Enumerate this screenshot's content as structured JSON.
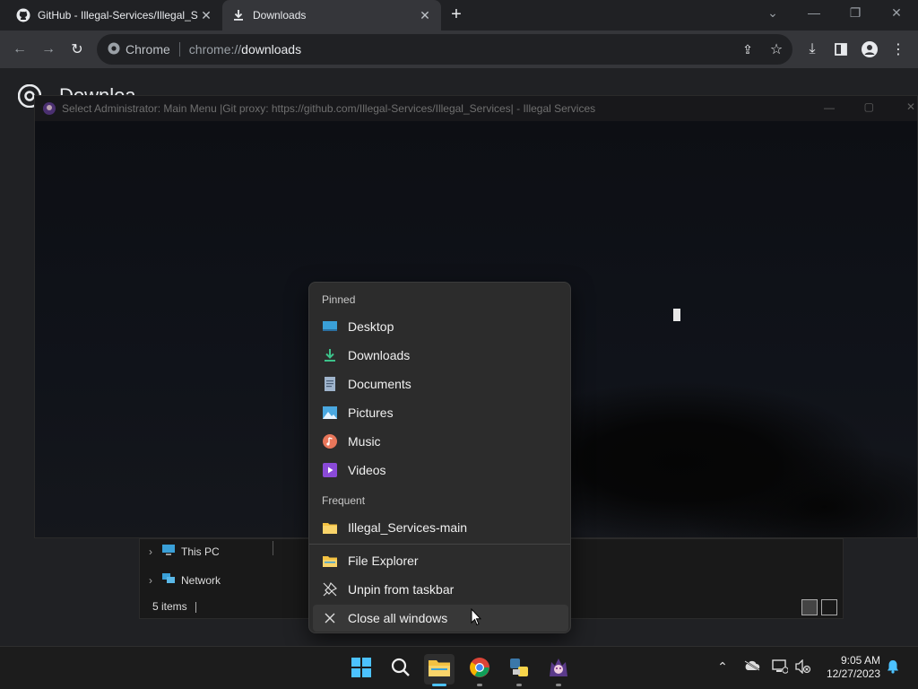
{
  "browser": {
    "tabs": [
      {
        "label": "GitHub - Illegal-Services/Illegal_S",
        "icon": "github-icon"
      },
      {
        "label": "Downloads",
        "icon": "download-icon"
      }
    ],
    "address_chip": "Chrome",
    "url_scheme": "chrome://",
    "url_host": "downloads",
    "page_title": "Downloa"
  },
  "terminal": {
    "title": "Select Administrator:  Main Menu |Git proxy: https://github.com/Illegal-Services/Illegal_Services| - Illegal Services"
  },
  "explorer": {
    "nav_items": [
      {
        "label": "This PC",
        "icon": "computer-icon"
      },
      {
        "label": "Network",
        "icon": "network-icon"
      }
    ],
    "status": "5 items"
  },
  "jumplist": {
    "pinned_header": "Pinned",
    "pinned": [
      {
        "label": "Desktop",
        "icon": "desktop-icon"
      },
      {
        "label": "Downloads",
        "icon": "downloads-icon"
      },
      {
        "label": "Documents",
        "icon": "documents-icon"
      },
      {
        "label": "Pictures",
        "icon": "pictures-icon"
      },
      {
        "label": "Music",
        "icon": "music-icon"
      },
      {
        "label": "Videos",
        "icon": "videos-icon"
      }
    ],
    "frequent_header": "Frequent",
    "frequent": [
      {
        "label": "Illegal_Services-main",
        "icon": "folder-icon"
      }
    ],
    "actions": [
      {
        "label": "File Explorer",
        "icon": "file-explorer-icon"
      },
      {
        "label": "Unpin from taskbar",
        "icon": "unpin-icon"
      },
      {
        "label": "Close all windows",
        "icon": "close-icon"
      }
    ]
  },
  "taskbar": {
    "apps": [
      "start-icon",
      "search-icon",
      "file-explorer-icon",
      "chrome-icon",
      "python-icon",
      "illegal-services-icon"
    ],
    "time": "9:05 AM",
    "date": "12/27/2023"
  },
  "colors": {
    "accent": "#4cc2ff",
    "background": "#202124"
  }
}
